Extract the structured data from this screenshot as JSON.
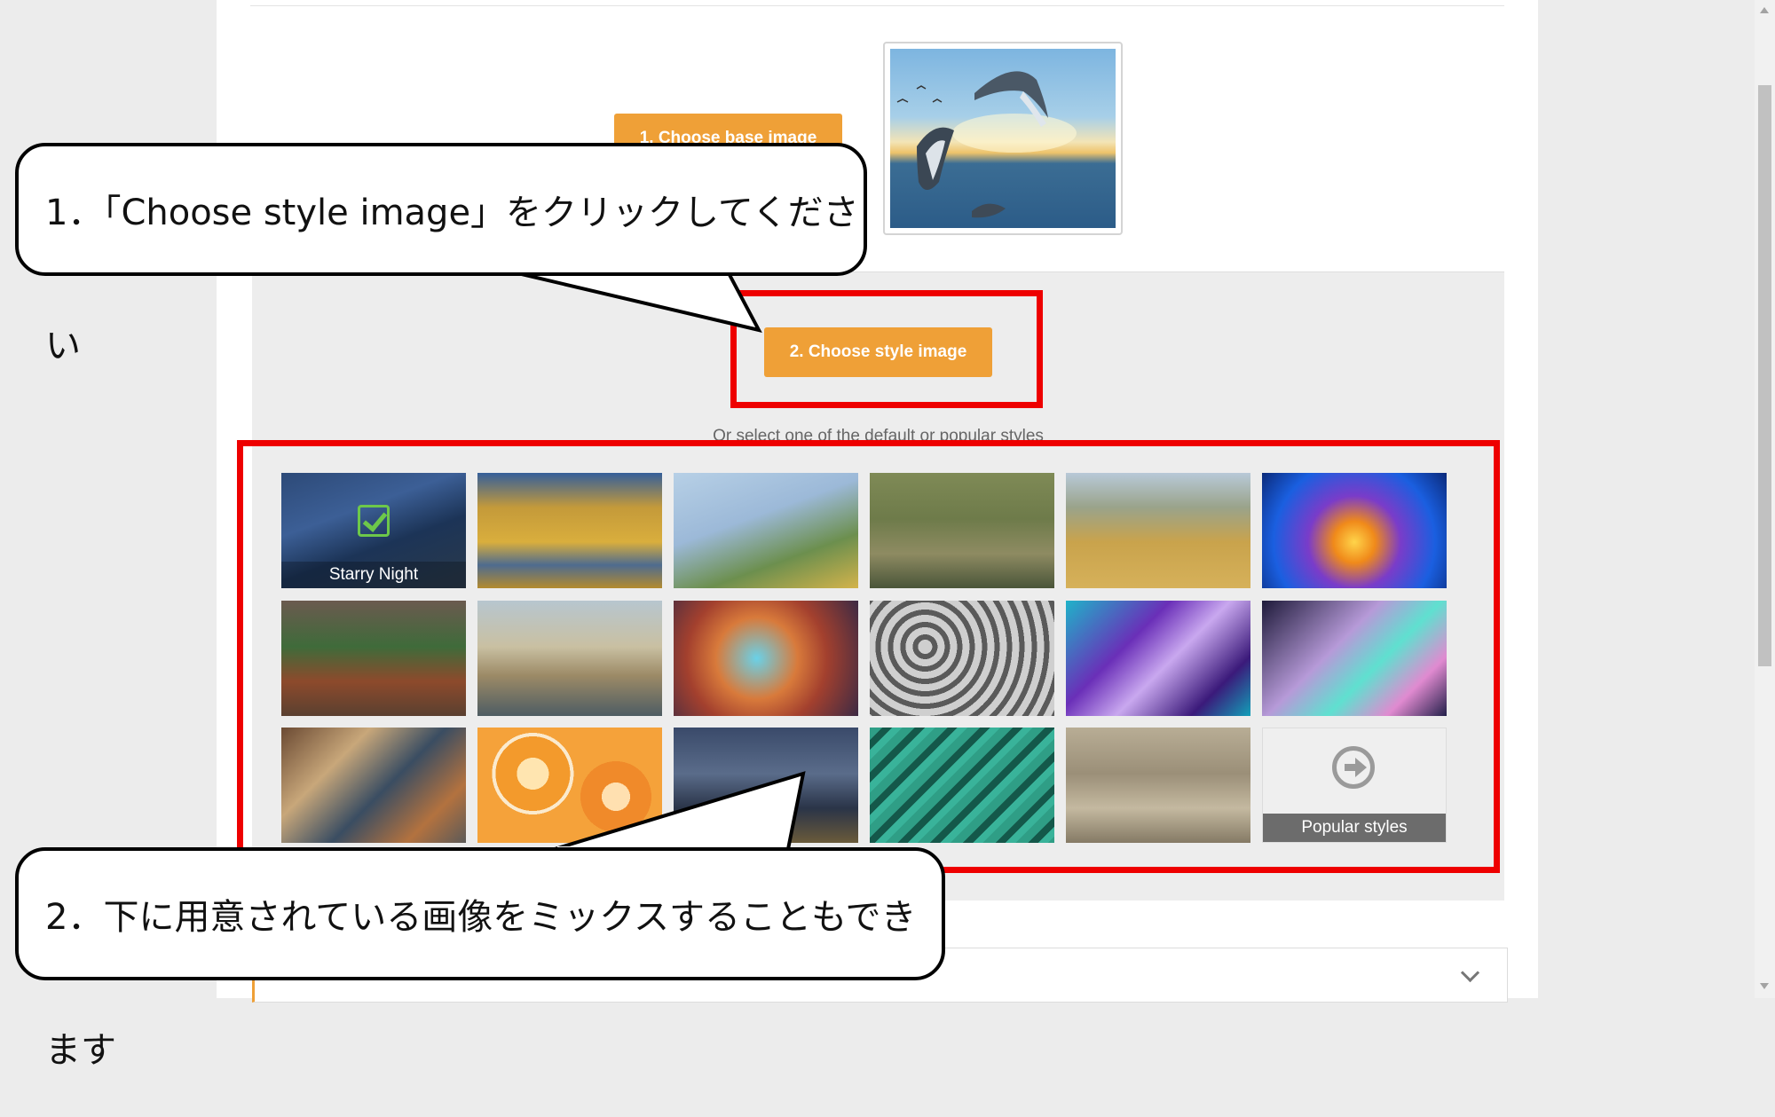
{
  "steps": {
    "base_button": "1. Choose base image",
    "style_button": "2. Choose style image",
    "hint": "Or select one of the default or popular styles"
  },
  "styles": {
    "selected_label": "Starry Night",
    "popular_label": "Popular styles"
  },
  "callouts": {
    "first": "1．「Choose style image」をクリックしてください",
    "second": "2．下に用意されている画像をミックスすることもできます"
  },
  "colors": {
    "accent": "#efa037",
    "highlight": "#ee0000",
    "check": "#6dc84a"
  }
}
